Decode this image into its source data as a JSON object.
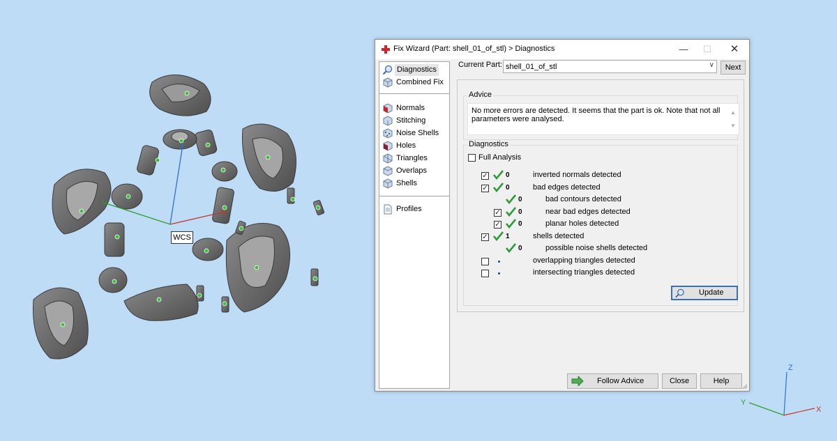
{
  "viewport": {
    "wcs_label": "WCS",
    "axis_x": "X",
    "axis_y": "Y",
    "axis_z": "Z",
    "mini_axis_x": "X",
    "mini_axis_y": "Y",
    "mini_axis_z": "Z",
    "colors": {
      "background": "#bfdcf7",
      "part_gray": "#707070",
      "marker": "#3fbf3f",
      "axis_x": "#c0392b",
      "axis_y": "#2e9e2e",
      "axis_z": "#2f6fd0"
    }
  },
  "dialog": {
    "title": "Fix Wizard (Part: shell_01_of_stl) > Diagnostics",
    "minimize_icon": "minimize-icon",
    "maximize_icon": "maximize-icon",
    "close_icon": "close-icon",
    "nav": {
      "items": [
        {
          "label": "Diagnostics",
          "icon": "magnifier-icon",
          "selected": true
        },
        {
          "label": "Combined Fix",
          "icon": "cube-icon"
        },
        {
          "label": "Normals",
          "icon": "normals-cube-icon"
        },
        {
          "label": "Stitching",
          "icon": "stitching-icon"
        },
        {
          "label": "Noise Shells",
          "icon": "noise-shells-icon"
        },
        {
          "label": "Holes",
          "icon": "holes-icon"
        },
        {
          "label": "Triangles",
          "icon": "triangles-icon"
        },
        {
          "label": "Overlaps",
          "icon": "overlaps-icon"
        },
        {
          "label": "Shells",
          "icon": "shells-icon"
        },
        {
          "label": "Profiles",
          "icon": "profiles-icon"
        }
      ]
    },
    "current_part_label": "Current Part:",
    "current_part_value": "shell_01_of_stl",
    "next_button": "Next",
    "advice": {
      "title": "Advice",
      "text": "No more errors are detected. It seems that the part is ok. Note that not all parameters were analysed."
    },
    "diagnostics": {
      "title": "Diagnostics",
      "full_analysis_label": "Full Analysis",
      "full_analysis_checked": false,
      "rows": [
        {
          "checked": true,
          "has_checkbox": true,
          "status": "ok",
          "count": "0",
          "label": "inverted normals detected",
          "indent": 0
        },
        {
          "checked": true,
          "has_checkbox": true,
          "status": "ok",
          "count": "0",
          "label": "bad edges detected",
          "indent": 0
        },
        {
          "checked": false,
          "has_checkbox": false,
          "status": "ok",
          "count": "0",
          "label": "bad contours detected",
          "indent": 1
        },
        {
          "checked": true,
          "has_checkbox": true,
          "status": "ok",
          "count": "0",
          "label": "near bad edges detected",
          "indent": 1
        },
        {
          "checked": true,
          "has_checkbox": true,
          "status": "ok",
          "count": "0",
          "label": "planar holes detected",
          "indent": 1
        },
        {
          "checked": true,
          "has_checkbox": true,
          "status": "ok",
          "count": "1",
          "label": "shells detected",
          "indent": 0
        },
        {
          "checked": false,
          "has_checkbox": false,
          "status": "ok",
          "count": "0",
          "label": "possible noise shells detected",
          "indent": 1
        },
        {
          "checked": false,
          "has_checkbox": true,
          "status": "none",
          "count": "",
          "label": "overlapping triangles detected",
          "indent": 0
        },
        {
          "checked": false,
          "has_checkbox": true,
          "status": "none",
          "count": "",
          "label": "intersecting triangles detected",
          "indent": 0
        }
      ],
      "update_button": "Update"
    },
    "footer": {
      "follow_advice_button": "Follow Advice",
      "close_button": "Close",
      "help_button": "Help"
    }
  }
}
